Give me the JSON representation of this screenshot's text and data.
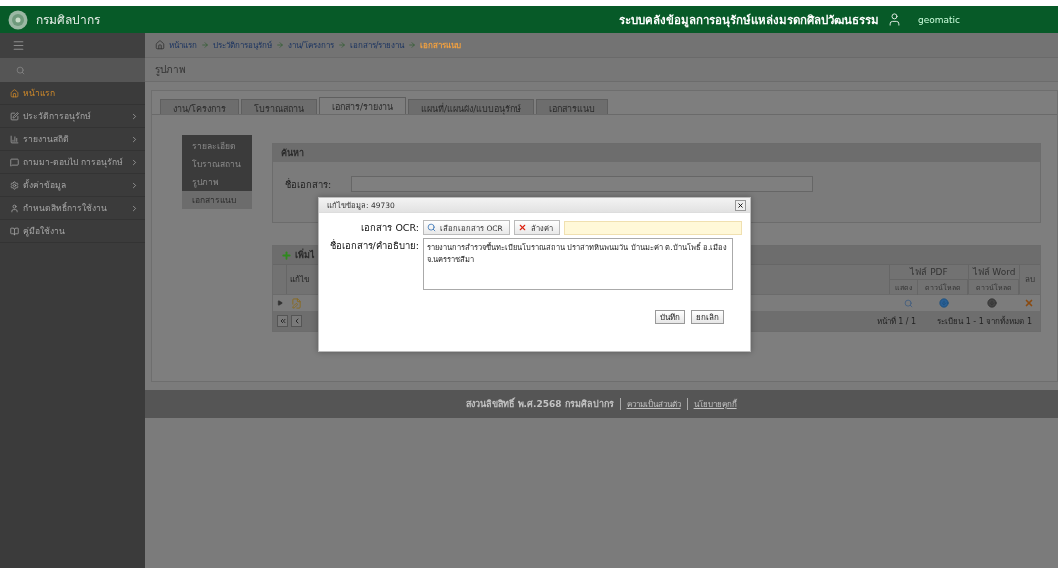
{
  "header": {
    "org_name": "กรมศิลปากร",
    "system_title": "ระบบคลังข้อมูลการอนุรักษ์แหล่งมรดกศิลปวัฒนธรรม",
    "user": "geomatic"
  },
  "sidebar": {
    "items": [
      {
        "label": "หน้าแรก",
        "kind": "home",
        "selected": true,
        "expandable": false
      },
      {
        "label": "ประวัติการอนุรักษ์",
        "kind": "edit",
        "selected": false,
        "expandable": true
      },
      {
        "label": "รายงานสถิติ",
        "kind": "chart",
        "selected": false,
        "expandable": true
      },
      {
        "label": "ถามมา-ตอบไป การอนุรักษ์",
        "kind": "chat",
        "selected": false,
        "expandable": true
      },
      {
        "label": "ตั้งค่าข้อมูล",
        "kind": "gear",
        "selected": false,
        "expandable": true
      },
      {
        "label": "กำหนดสิทธิ์การใช้งาน",
        "kind": "user",
        "selected": false,
        "expandable": true
      },
      {
        "label": "คู่มือใช้งาน",
        "kind": "book",
        "selected": false,
        "expandable": false
      }
    ]
  },
  "breadcrumb": [
    {
      "label": "หน้าแรก",
      "current": false
    },
    {
      "label": "ประวัติการอนุรักษ์",
      "current": false
    },
    {
      "label": "งาน/โครงการ",
      "current": false
    },
    {
      "label": "เอกสาร/รายงาน",
      "current": false
    },
    {
      "label": "เอกสารแนบ",
      "current": true
    }
  ],
  "page_title": "รูปภาพ",
  "tabs": [
    {
      "label": "งาน/โครงการ",
      "selected": false
    },
    {
      "label": "โบราณสถาน",
      "selected": false
    },
    {
      "label": "เอกสาร/รายงาน",
      "selected": true
    },
    {
      "label": "แผนที่/แผนผัง/แบบอนุรักษ์",
      "selected": false
    },
    {
      "label": "เอกสารแนบ",
      "selected": false
    }
  ],
  "sub_menu": [
    {
      "label": "รายละเอียด",
      "selected": false
    },
    {
      "label": "โบราณสถาน",
      "selected": false
    },
    {
      "label": "รูปภาพ",
      "selected": false
    },
    {
      "label": "เอกสารแนบ",
      "selected": true
    }
  ],
  "search_panel": {
    "title": "ค้นหา",
    "field_label": "ชื่อเอกสาร:"
  },
  "grid": {
    "add_label": "เพิ่มไ",
    "edit_column": "แก้ไข",
    "pdf_group": "ไฟล์ PDF",
    "word_group": "ไฟล์ Word",
    "delete_column": "ลบ",
    "subcolumns": [
      "แสดง",
      "ดาวน์โหลด",
      "ดาวน์โหลด"
    ],
    "page_info": "หน้าที่ 1 / 1",
    "record_info": "ระเบียน 1 - 1 จากทั้งหมด 1"
  },
  "dialog": {
    "title": "แก้ไขข้อมูล: 49730",
    "ocr_label": "เอกสาร OCR:",
    "choose_button": "เลือกเอกสาร OCR",
    "clear_button": "ล้างค่า",
    "description_label": "ชื่อเอกสาร/คำอธิบาย:",
    "description": "รายงานการสำรวจขึ้นทะเบียนโบราณสถาน ปราสาทหินพนมวัน บ้านมะค่า ต.บ้านโพธิ์ อ.เมือง จ.นครราชสีมา",
    "save_button": "บันทึก",
    "cancel_button": "ยกเลิก"
  },
  "footer": {
    "copyright": "สงวนลิขสิทธิ์ พ.ศ.2568 กรมศิลปากร",
    "links": [
      "ความเป็นส่วนตัว",
      "นโยบายคุกกี้"
    ]
  }
}
